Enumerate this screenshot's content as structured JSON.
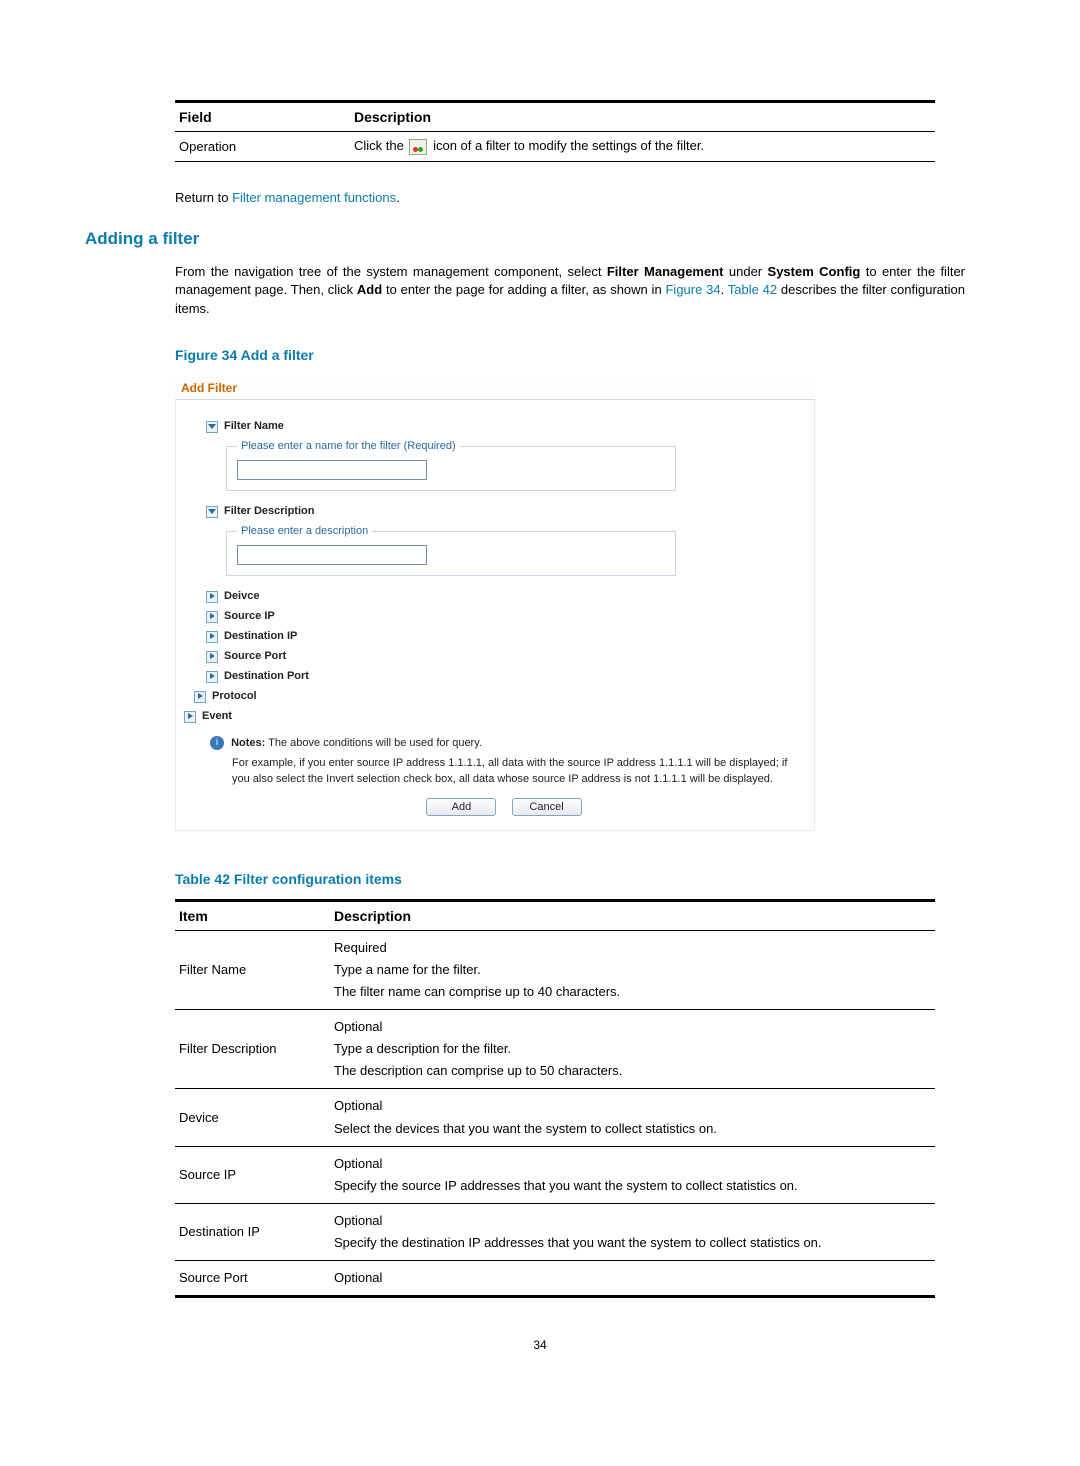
{
  "top_table": {
    "head": {
      "field": "Field",
      "desc": "Description"
    },
    "row": {
      "field": "Operation",
      "desc_before": "Click the ",
      "desc_after": " icon of a filter to modify the settings of the filter."
    }
  },
  "return": {
    "prefix": "Return to ",
    "link": "Filter management functions",
    "suffix": "."
  },
  "section_title": "Adding a filter",
  "intro": {
    "part1": "From the navigation tree of the system management component, select ",
    "bold1": "Filter Management",
    "part2": " under ",
    "bold2": "System Config",
    "part3": " to enter the filter management page. Then, click ",
    "bold3": "Add",
    "part4": " to enter the page for adding a filter, as shown in ",
    "link1": "Figure 34",
    "part5": ". ",
    "link2": "Table 42",
    "part6": " describes the filter configuration items."
  },
  "figure_label": "Figure 34 Add a filter",
  "form": {
    "title": "Add Filter",
    "filter_name": {
      "label": "Filter Name",
      "legend": "Please enter a name for the filter (Required)",
      "value": ""
    },
    "filter_desc": {
      "label": "Filter Description",
      "legend": "Please enter a description",
      "value": ""
    },
    "rows": {
      "device": "Deivce",
      "source_ip": "Source IP",
      "dest_ip": "Destination IP",
      "source_port": "Source Port",
      "dest_port": "Destination Port",
      "protocol": "Protocol",
      "event": "Event"
    },
    "notes": {
      "heading": "Notes:",
      "heading_rest": "The above conditions will be used for query.",
      "example": "For example, if you enter source IP address 1.1.1.1, all data with the source IP address 1.1.1.1 will be displayed; if you also select the Invert selection check box, all data whose source IP address is not 1.1.1.1 will be displayed."
    },
    "buttons": {
      "add": "Add",
      "cancel": "Cancel"
    }
  },
  "table_label": "Table 42 Filter configuration items",
  "cfg": {
    "head": {
      "item": "Item",
      "desc": "Description"
    },
    "rows": [
      {
        "item": "Filter Name",
        "lines": [
          "Required",
          "Type a name for the filter.",
          "The filter name can comprise up to 40 characters."
        ]
      },
      {
        "item": "Filter Description",
        "lines": [
          "Optional",
          "Type a description for the filter.",
          "The description can comprise up to 50 characters."
        ]
      },
      {
        "item": "Device",
        "lines": [
          "Optional",
          "Select the devices that you want the system to collect statistics on."
        ]
      },
      {
        "item": "Source IP",
        "lines": [
          "Optional",
          "Specify the source IP addresses that you want the system to collect statistics on."
        ]
      },
      {
        "item": "Destination IP",
        "lines": [
          "Optional",
          "Specify the destination IP addresses that you want the system to collect statistics on."
        ]
      },
      {
        "item": "Source Port",
        "lines": [
          "Optional"
        ]
      }
    ]
  },
  "page_number": "34"
}
